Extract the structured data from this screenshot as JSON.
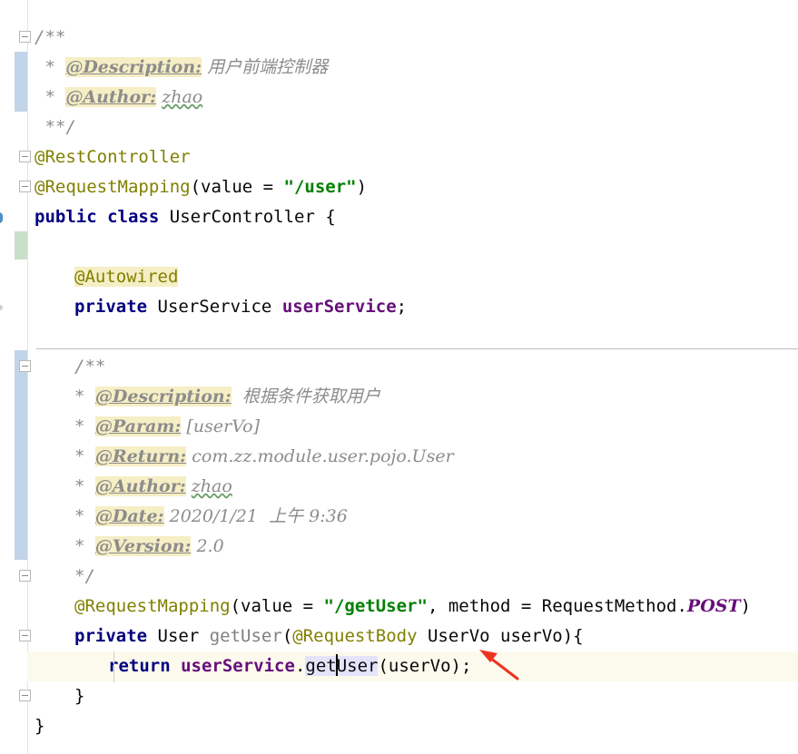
{
  "editor": {
    "lines": {
      "c1_open": "/**",
      "c1_star": " * ",
      "c1_desc_tag": "@Description:",
      "c1_desc_text": " 用户前端控制器",
      "c1_author_tag": "@Author:",
      "c1_author_text": "zhao",
      "c1_close": " **/",
      "ann_rest": "@RestController",
      "ann_map1": "@RequestMapping",
      "ann_map1_args_a": "(value = ",
      "ann_map1_str": "\"/user\"",
      "ann_map1_args_b": ")",
      "cls_public": "public",
      "cls_class": "class",
      "cls_rest": "UserController {",
      "autowired": "@Autowired",
      "fld_private": "private",
      "fld_type": "UserService ",
      "fld_name": "userService",
      "fld_semi": ";",
      "c2_open": "/**",
      "c2_star": "* ",
      "c2_desc_tag": "@Description:",
      "c2_desc_text": "  根据条件获取用户",
      "c2_param_tag": "@Param:",
      "c2_param_text": " [userVo]",
      "c2_return_tag": "@Return:",
      "c2_return_text": " com.zz.module.user.pojo.User",
      "c2_author_tag": "@Author:",
      "c2_author_text": "zhao",
      "c2_date_tag": "@Date:",
      "c2_date_text": " 2020/1/21  上午 9:36",
      "c2_version_tag": "@Version:",
      "c2_version_text": " 2.0",
      "c2_close": "*/",
      "m_ann": "@RequestMapping",
      "m_args_a": "(value = ",
      "m_str": "\"/getUser\"",
      "m_args_b": ", method = RequestMethod.",
      "m_const": "POST",
      "m_args_c": ")",
      "m_private": "private",
      "m_ret": "User ",
      "m_name": "getUser",
      "m_paren": "(",
      "m_param_ann": "@RequestBody",
      "m_param": " UserVo userVo){",
      "r_return": "return",
      "r_field": "userService",
      "r_dot": ".",
      "r_call_a": "get",
      "r_call_b": "User",
      "r_args": "(userVo);",
      "close_method": "}",
      "close_class": "}"
    },
    "annotation_arrow_color": "#ee3322"
  }
}
